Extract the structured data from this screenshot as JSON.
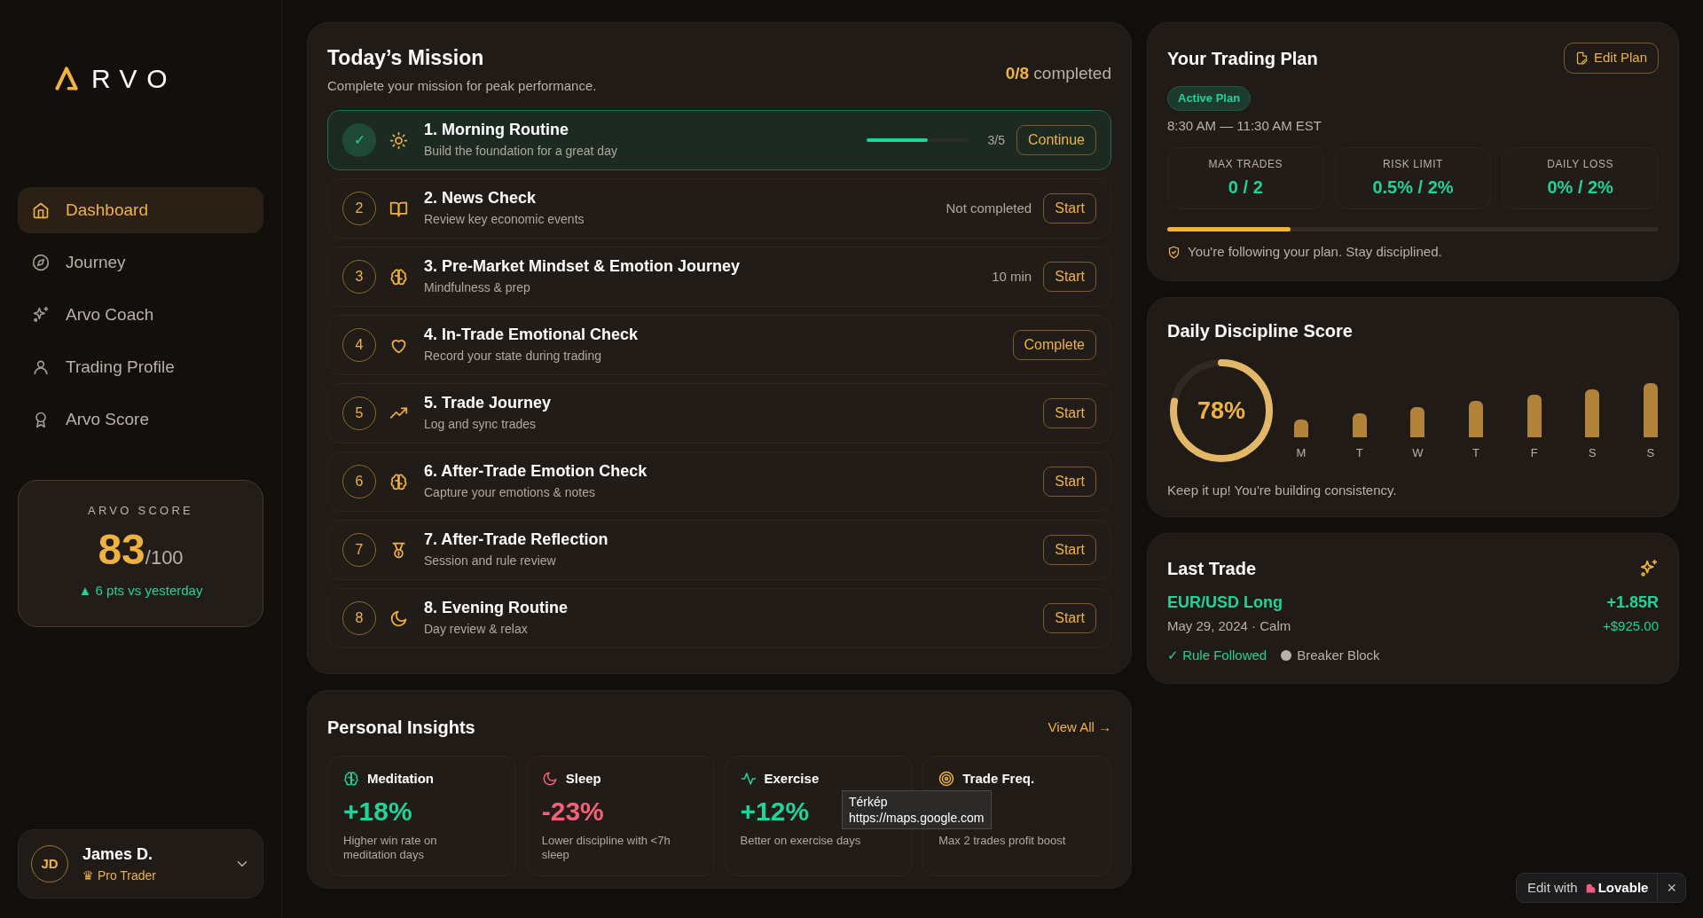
{
  "brand": {
    "logo": "RVO"
  },
  "nav": [
    {
      "label": "Dashboard",
      "selected": true
    },
    {
      "label": "Journey",
      "selected": false
    },
    {
      "label": "Arvo Coach",
      "selected": false
    },
    {
      "label": "Trading Profile",
      "selected": false
    },
    {
      "label": "Arvo Score",
      "selected": false
    }
  ],
  "score_card": {
    "title": "ARVO SCORE",
    "score": "83",
    "max": "/100",
    "change": "▲ 6 pts vs yesterday"
  },
  "user": {
    "initials": "JD",
    "name": "James D.",
    "plan": "♛ Pro Trader"
  },
  "mission": {
    "title": "Today’s Mission",
    "subtitle": "Complete your mission for peak performance.",
    "count": "0/8",
    "count_label": "completed",
    "tasks": [
      {
        "marker": "✓",
        "title": "1. Morning Routine",
        "desc": "Build the foundation for a great day",
        "kind": "progress",
        "active": true,
        "level": 0.6,
        "reading": "3/5",
        "action": "Continue"
      },
      {
        "marker": "2",
        "title": "2. News Check",
        "desc": "Review key economic events",
        "kind": "status",
        "active": false,
        "status": "Not completed",
        "action": "Start"
      },
      {
        "marker": "3",
        "title": "3. Pre-Market Mindset & Emotion Journey",
        "desc": "Mindfulness & prep",
        "kind": "status",
        "active": false,
        "status": "10 min",
        "action": "Start"
      },
      {
        "marker": "4",
        "title": "4. In-Trade Emotional Check",
        "desc": "Record your state during trading",
        "kind": "plain",
        "active": false,
        "action": "Complete"
      },
      {
        "marker": "5",
        "title": "5. Trade Journey",
        "desc": "Log and sync trades",
        "kind": "plain",
        "active": false,
        "action": "Start"
      },
      {
        "marker": "6",
        "title": "6. After-Trade Emotion Check",
        "desc": "Capture your emotions & notes",
        "kind": "plain",
        "active": false,
        "action": "Start"
      },
      {
        "marker": "7",
        "title": "7. After-Trade Reflection",
        "desc": "Session and rule review",
        "kind": "plain",
        "active": false,
        "action": "Start"
      },
      {
        "marker": "8",
        "title": "8. Evening Routine",
        "desc": "Day review & relax",
        "kind": "plain",
        "active": false,
        "action": "Start"
      }
    ]
  },
  "insights": {
    "title": "Personal Insights",
    "link": "View All →",
    "items": [
      {
        "label": "Meditation",
        "value": "+18%",
        "color": "#1fd39a",
        "desc": "Higher win rate on meditation days"
      },
      {
        "label": "Sleep",
        "value": "-23%",
        "color": "#f2607a",
        "desc": "Lower discipline with <7h sleep"
      },
      {
        "label": "Exercise",
        "value": "+12%",
        "color": "#1fd39a",
        "desc": "Better on exercise days"
      },
      {
        "label": "Trade Freq.",
        "desc": "Max 2 trades profit boost"
      }
    ]
  },
  "tooltip": {
    "title": "Térkép",
    "url": "https://maps.google.com"
  },
  "plan": {
    "title": "Your Trading Plan",
    "edit": "Edit Plan",
    "badge": "Active Plan",
    "hours": "8:30 AM — 11:30 AM EST",
    "stats": [
      {
        "label": "MAX TRADES",
        "value": "0 / 2"
      },
      {
        "label": "RISK LIMIT",
        "value": "0.5% / 2%"
      },
      {
        "label": "DAILY LOSS",
        "value": "0% / 2%"
      }
    ],
    "level": 0.25,
    "note": "You're following your plan. Stay disciplined."
  },
  "discipline": {
    "title": "Daily Discipline Score",
    "level": 0.78,
    "reading": "78%",
    "days": [
      "M",
      "T",
      "W",
      "T",
      "F",
      "S",
      "S"
    ],
    "note": "Keep it up! You're building consistency."
  },
  "last_trade": {
    "title": "Last Trade",
    "pair": "EUR/USD Long",
    "meta": "May 29, 2024 · Calm",
    "r": "+1.85R",
    "pnl": "+$925.00",
    "rule": "✓ Rule Followed",
    "tag": "Breaker Block"
  },
  "lovable": {
    "prefix": "Edit with",
    "brand": "Lovable",
    "close": "×"
  }
}
